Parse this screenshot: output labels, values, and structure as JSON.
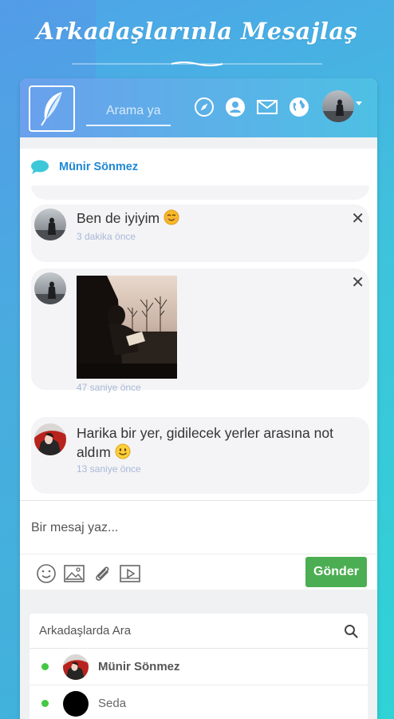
{
  "hero": {
    "title": "Arkadaşlarınla Mesajlaş"
  },
  "topbar": {
    "search_placeholder": "Arama ya",
    "icons": [
      "feather-logo-icon",
      "compass-icon",
      "profile-icon",
      "mail-icon",
      "globe-icon"
    ]
  },
  "chat": {
    "contact_name": "Münir Sönmez",
    "messages": [
      {
        "text": "Ben de iyiyim",
        "emoji": "smile-emoji",
        "time": "3 dakika önce",
        "closable": true
      },
      {
        "type": "image",
        "time": "47 saniye önce",
        "closable": true
      },
      {
        "text": "Harika bir yer, gidilecek yerler arasına not aldım",
        "emoji": "smile-emoji",
        "time": "13 saniye önce"
      }
    ]
  },
  "composer": {
    "placeholder": "Bir mesaj yaz...",
    "send_label": "Gönder",
    "tools": [
      "emoji-icon",
      "image-icon",
      "attachment-icon",
      "video-icon"
    ]
  },
  "friends": {
    "search_placeholder": "Arkadaşlarda Ara",
    "list": [
      {
        "name": "Münir Sönmez",
        "online": true,
        "active": true
      },
      {
        "name": "Seda",
        "online": true
      }
    ]
  },
  "colors": {
    "accent_blue": "#1e88d6",
    "send_green": "#4cae52",
    "online_green": "#44c744",
    "time_text": "#a8b8d8"
  }
}
